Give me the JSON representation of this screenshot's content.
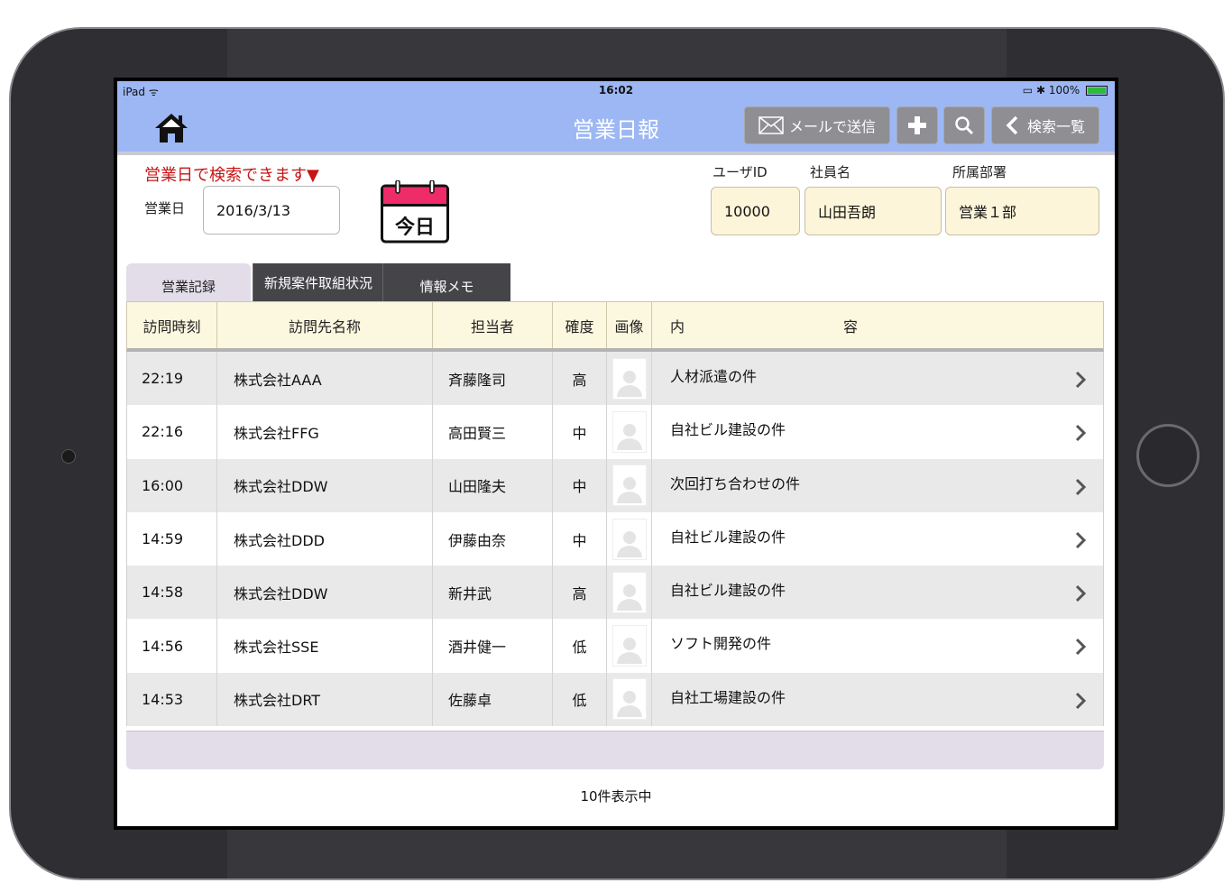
{
  "status_bar": {
    "carrier": "iPad",
    "time": "16:02",
    "battery_text": "100%"
  },
  "nav": {
    "title": "営業日報",
    "mail_button": "メールで送信",
    "back_button": "検索一覧",
    "icons": [
      "home-icon",
      "mail-icon",
      "plus-icon",
      "search-icon",
      "chevron-left-icon"
    ]
  },
  "filters": {
    "hint": "営業日で検索できます▼",
    "date_label": "営業日",
    "date_value": "2016/3/13",
    "today_label": "今日",
    "user_id_label": "ユーザID",
    "user_id_value": "10000",
    "name_label": "社員名",
    "name_value": "山田吾朗",
    "dept_label": "所属部署",
    "dept_value": "営業１部"
  },
  "tabs": [
    {
      "label": "営業記録",
      "active": true
    },
    {
      "label": "新規案件取組状況",
      "active": false
    },
    {
      "label": "情報メモ",
      "active": false
    }
  ],
  "table": {
    "headers": [
      "訪問時刻",
      "訪問先名称",
      "担当者",
      "確度",
      "画像",
      "内　　　　　　　　　　　容"
    ],
    "rows": [
      {
        "time": "22:19",
        "company": "株式会社AAA",
        "person": "斉藤隆司",
        "certainty": "高",
        "content": "人材派遣の件"
      },
      {
        "time": "22:16",
        "company": "株式会社FFG",
        "person": "高田賢三",
        "certainty": "中",
        "content": "自社ビル建設の件"
      },
      {
        "time": "16:00",
        "company": "株式会社DDW",
        "person": "山田隆夫",
        "certainty": "中",
        "content": "次回打ち合わせの件"
      },
      {
        "time": "14:59",
        "company": "株式会社DDD",
        "person": "伊藤由奈",
        "certainty": "中",
        "content": "自社ビル建設の件"
      },
      {
        "time": "14:58",
        "company": "株式会社DDW",
        "person": "新井武",
        "certainty": "高",
        "content": "自社ビル建設の件"
      },
      {
        "time": "14:56",
        "company": "株式会社SSE",
        "person": "酒井健一",
        "certainty": "低",
        "content": "ソフト開発の件"
      },
      {
        "time": "14:53",
        "company": "株式会社DRT",
        "person": "佐藤卓",
        "certainty": "低",
        "content": "自社工場建設の件"
      }
    ]
  },
  "footer": {
    "count_text": "10件表示中"
  },
  "colors": {
    "nav_bg": "#9cb7f4",
    "hint_red": "#c81414",
    "today_pink": "#ee2c6a",
    "header_cream": "#fcf7df",
    "user_field_bg": "#fdf5d9"
  }
}
